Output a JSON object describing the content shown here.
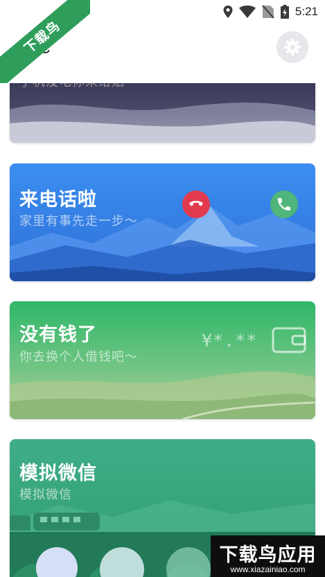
{
  "status_bar": {
    "time": "5:21",
    "icons": [
      "location-icon",
      "wifi-icon",
      "no-sim-icon",
      "battery-charging-icon"
    ]
  },
  "app_bar": {
    "title": "LSC",
    "settings_icon": "gear-icon"
  },
  "cards": {
    "top": {
      "subtitle": "手机没电你来给贴"
    },
    "call": {
      "title": "来电话啦",
      "subtitle": "家里有事先走一步～",
      "decline_icon": "phone-hangup-icon",
      "accept_icon": "phone-icon",
      "colors": {
        "decline": "#e23a4e",
        "accept": "#4fb57a"
      }
    },
    "money": {
      "title": "没有钱了",
      "subtitle": "你去换个人借钱吧～",
      "amount": "¥*.**",
      "icon": "wallet-icon"
    },
    "wechat": {
      "title": "模拟微信",
      "subtitle": "模拟微信"
    }
  },
  "watermark": {
    "ribbon": "下载鸟",
    "main": "下载鸟应用",
    "url": "www.xiazainiao.com"
  }
}
